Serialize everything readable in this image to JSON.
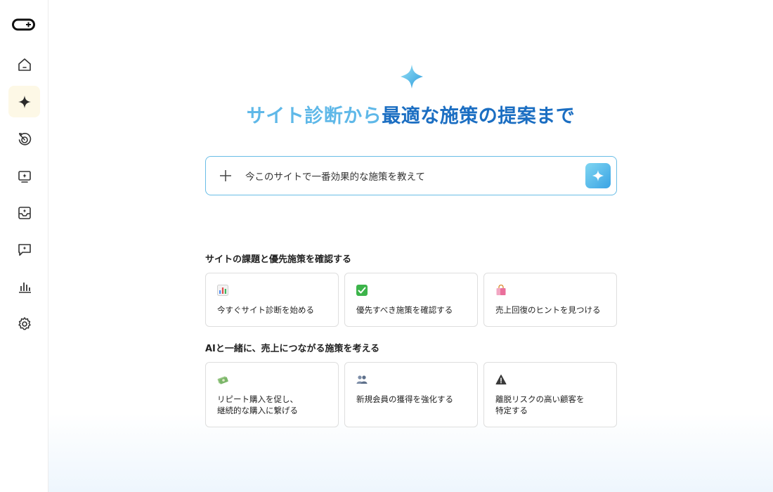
{
  "sidebar": {
    "items": [
      {
        "name": "home",
        "icon": "home-icon"
      },
      {
        "name": "ai",
        "icon": "sparkle-icon",
        "active": true
      },
      {
        "name": "history",
        "icon": "target-history-icon"
      },
      {
        "name": "monitor",
        "icon": "monitor-sparkle-icon"
      },
      {
        "name": "inbox",
        "icon": "inbox-sparkle-icon"
      },
      {
        "name": "chat",
        "icon": "chat-sparkle-icon"
      },
      {
        "name": "analytics",
        "icon": "bar-chart-icon"
      },
      {
        "name": "settings",
        "icon": "gear-icon"
      }
    ]
  },
  "hero": {
    "title_highlight": "サイト診断から",
    "title_rest": "最適な施策の提案まで"
  },
  "prompt": {
    "value": "今このサイトで一番効果的な施策を教えて",
    "placeholder": "今このサイトで一番効果的な施策を教えて"
  },
  "sections": [
    {
      "title": "サイトの課題と優先施策を確認する",
      "cards": [
        {
          "icon": "bar-chart-emoji-icon",
          "lines": [
            "今すぐサイト診断を始める"
          ]
        },
        {
          "icon": "check-mark-emoji-icon",
          "lines": [
            "優先すべき施策を確認する"
          ]
        },
        {
          "icon": "shopping-bag-emoji-icon",
          "lines": [
            "売上回復のヒントを見つける"
          ]
        }
      ]
    },
    {
      "title": "AIと一緒に、売上につながる施策を考える",
      "cards": [
        {
          "icon": "money-emoji-icon",
          "lines": [
            "リピート購入を促し、",
            "継続的な購入に繋げる"
          ]
        },
        {
          "icon": "people-emoji-icon",
          "lines": [
            "新規会員の獲得を強化する"
          ]
        },
        {
          "icon": "warning-emoji-icon",
          "lines": [
            "離脱リスクの高い顧客を",
            "特定する"
          ]
        }
      ]
    }
  ],
  "colors": {
    "accent_light": "#5fb8e8",
    "accent_dark": "#1b6ec2",
    "active_nav_bg": "#fdf8e6"
  }
}
